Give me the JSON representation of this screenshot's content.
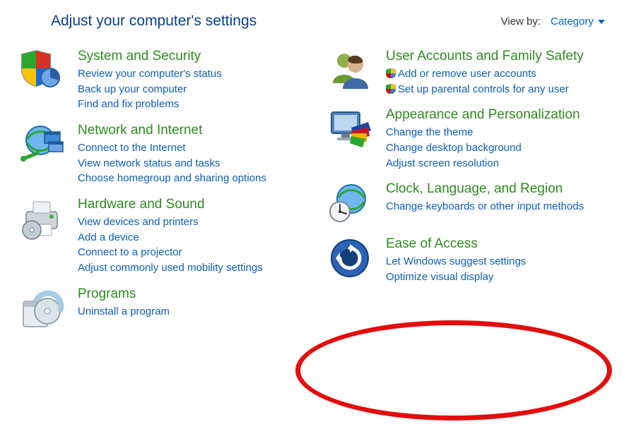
{
  "header": {
    "title": "Adjust your computer's settings",
    "viewby_label": "View by:",
    "viewby_value": "Category"
  },
  "left": [
    {
      "id": "system-security",
      "icon": "shield-pie",
      "title": "System and Security",
      "links": [
        {
          "text": "Review your computer's status"
        },
        {
          "text": "Back up your computer"
        },
        {
          "text": "Find and fix problems"
        }
      ]
    },
    {
      "id": "network-internet",
      "icon": "globe-net",
      "title": "Network and Internet",
      "links": [
        {
          "text": "Connect to the Internet"
        },
        {
          "text": "View network status and tasks"
        },
        {
          "text": "Choose homegroup and sharing options"
        }
      ]
    },
    {
      "id": "hardware-sound",
      "icon": "printer",
      "title": "Hardware and Sound",
      "links": [
        {
          "text": "View devices and printers"
        },
        {
          "text": "Add a device"
        },
        {
          "text": "Connect to a projector"
        },
        {
          "text": "Adjust commonly used mobility settings"
        }
      ]
    },
    {
      "id": "programs",
      "icon": "disc-box",
      "title": "Programs",
      "links": [
        {
          "text": "Uninstall a program"
        }
      ]
    }
  ],
  "right": [
    {
      "id": "user-accounts",
      "icon": "people",
      "title": "User Accounts and Family Safety",
      "links": [
        {
          "text": "Add or remove user accounts",
          "shield": true
        },
        {
          "text": "Set up parental controls for any user",
          "shield": true
        }
      ]
    },
    {
      "id": "appearance",
      "icon": "monitor-paint",
      "title": "Appearance and Personalization",
      "links": [
        {
          "text": "Change the theme"
        },
        {
          "text": "Change desktop background"
        },
        {
          "text": "Adjust screen resolution"
        }
      ]
    },
    {
      "id": "clock-lang-region",
      "icon": "globe-clock",
      "title": "Clock, Language, and Region",
      "links": [
        {
          "text": "Change keyboards or other input methods"
        }
      ]
    },
    {
      "id": "ease-of-access",
      "icon": "ease-access",
      "title": "Ease of Access",
      "links": [
        {
          "text": "Let Windows suggest settings"
        },
        {
          "text": "Optimize visual display"
        }
      ]
    }
  ],
  "highlight": {
    "target": "ease-of-access"
  }
}
